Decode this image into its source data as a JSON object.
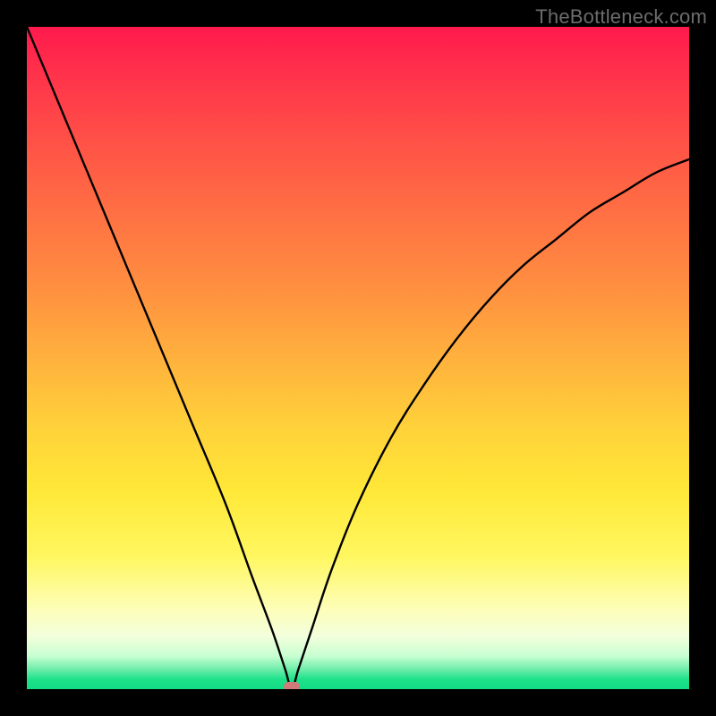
{
  "attribution": "TheBottleneck.com",
  "colors": {
    "frame": "#000000",
    "curve": "#000000",
    "marker": "#d07a7a",
    "gradient_top": "#ff1a4d",
    "gradient_mid": "#ffd03a",
    "gradient_bottom": "#12db84"
  },
  "chart_data": {
    "type": "line",
    "title": "",
    "xlabel": "",
    "ylabel": "",
    "xlim": [
      0,
      100
    ],
    "ylim": [
      0,
      100
    ],
    "grid": false,
    "legend": false,
    "note": "V-shaped bottleneck curve; y ≈ 100 is worst (red), y ≈ 0 is best (green). Minimum near x ≈ 40 marked with a small rounded pill.",
    "series": [
      {
        "name": "bottleneck",
        "x": [
          0,
          5,
          10,
          15,
          20,
          25,
          30,
          34,
          37,
          39,
          40,
          41,
          43,
          46,
          50,
          55,
          60,
          65,
          70,
          75,
          80,
          85,
          90,
          95,
          100
        ],
        "values": [
          100,
          88,
          76,
          64,
          52,
          40,
          28,
          17,
          9,
          3,
          0,
          3,
          9,
          18,
          28,
          38,
          46,
          53,
          59,
          64,
          68,
          72,
          75,
          78,
          80
        ]
      }
    ],
    "marker": {
      "x": 40,
      "y": 0,
      "shape": "pill"
    }
  }
}
